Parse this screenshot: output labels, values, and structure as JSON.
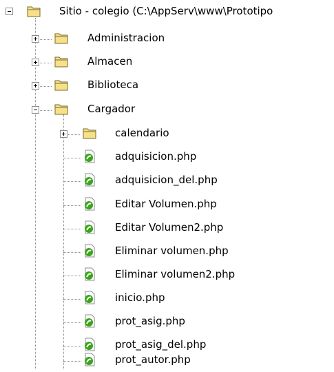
{
  "tree": {
    "root": {
      "label": "Sitio - colegio (C:\\AppServ\\www\\Prototipo",
      "expanded": true,
      "icon": "folder-icon"
    },
    "folders": [
      {
        "label": "Administracion",
        "expanded": false,
        "icon": "folder-icon"
      },
      {
        "label": "Almacen",
        "expanded": false,
        "icon": "folder-icon"
      },
      {
        "label": "Biblioteca",
        "expanded": false,
        "icon": "folder-icon"
      },
      {
        "label": "Cargador",
        "expanded": true,
        "icon": "folder-icon"
      }
    ],
    "cargador": {
      "subfolders": [
        {
          "label": "calendario",
          "expanded": false,
          "icon": "folder-icon"
        }
      ],
      "files": [
        {
          "label": "adquisicion.php",
          "icon": "php-file-icon"
        },
        {
          "label": "adquisicion_del.php",
          "icon": "php-file-icon"
        },
        {
          "label": "Editar Volumen.php",
          "icon": "php-file-icon"
        },
        {
          "label": "Editar Volumen2.php",
          "icon": "php-file-icon"
        },
        {
          "label": "Eliminar volumen.php",
          "icon": "php-file-icon"
        },
        {
          "label": "Eliminar volumen2.php",
          "icon": "php-file-icon"
        },
        {
          "label": "inicio.php",
          "icon": "php-file-icon"
        },
        {
          "label": "prot_asig.php",
          "icon": "php-file-icon"
        },
        {
          "label": "prot_asig_del.php",
          "icon": "php-file-icon"
        },
        {
          "label": "prot_autor.php",
          "icon": "php-file-icon"
        }
      ]
    }
  },
  "colors": {
    "folder_fill": "#f6e08a",
    "folder_stroke": "#7a6a2a",
    "php_green": "#3aa51a",
    "line": "#8c8c8c"
  }
}
